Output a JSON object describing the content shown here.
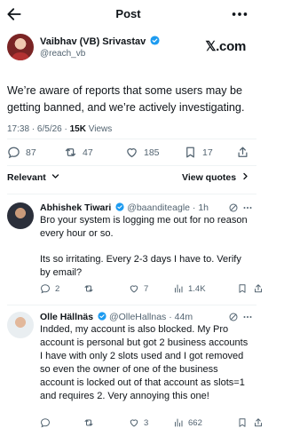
{
  "header": {
    "title": "Post"
  },
  "post": {
    "author_name": "Vaibhav (VB) Srivastav",
    "author_handle": "@reach_vb",
    "brand": "𝕏.com",
    "text": "We’re aware of reports that some users may be getting banned, and we’re actively investigating.",
    "time": "17:38",
    "date": "6/5/26",
    "views_count": "15K",
    "views_label": "Views",
    "replies": "87",
    "reposts": "47",
    "likes": "185",
    "bookmarks": "17"
  },
  "sort": {
    "label": "Relevant",
    "view_quotes": "View quotes"
  },
  "replies": [
    {
      "name": "Abhishek Tiwari",
      "handle": "@baanditeagle",
      "age": "1h",
      "text1": "Bro your system is logging me out for no reason every hour or so.",
      "text2": "Its so irritating. Every 2-3 days I have to. Verify by email?",
      "replies": "2",
      "reposts": "",
      "likes": "7",
      "views": "1.4K"
    },
    {
      "name": "Olle Hällnäs",
      "handle": "@OlleHallnas",
      "age": "44m",
      "text1": "Indded, my account is also blocked. My Pro account is personal but got 2 business accounts I have with only 2 slots used and I got removed so even the owner of one of the business account is locked out of that account as slots=1 and requires 2. Very annoying this one!",
      "replies": "",
      "reposts": "",
      "likes": "3",
      "views": "662"
    }
  ],
  "colors": {
    "verified": "#1d9bf0",
    "muted": "#536471",
    "text": "#0f1419"
  }
}
